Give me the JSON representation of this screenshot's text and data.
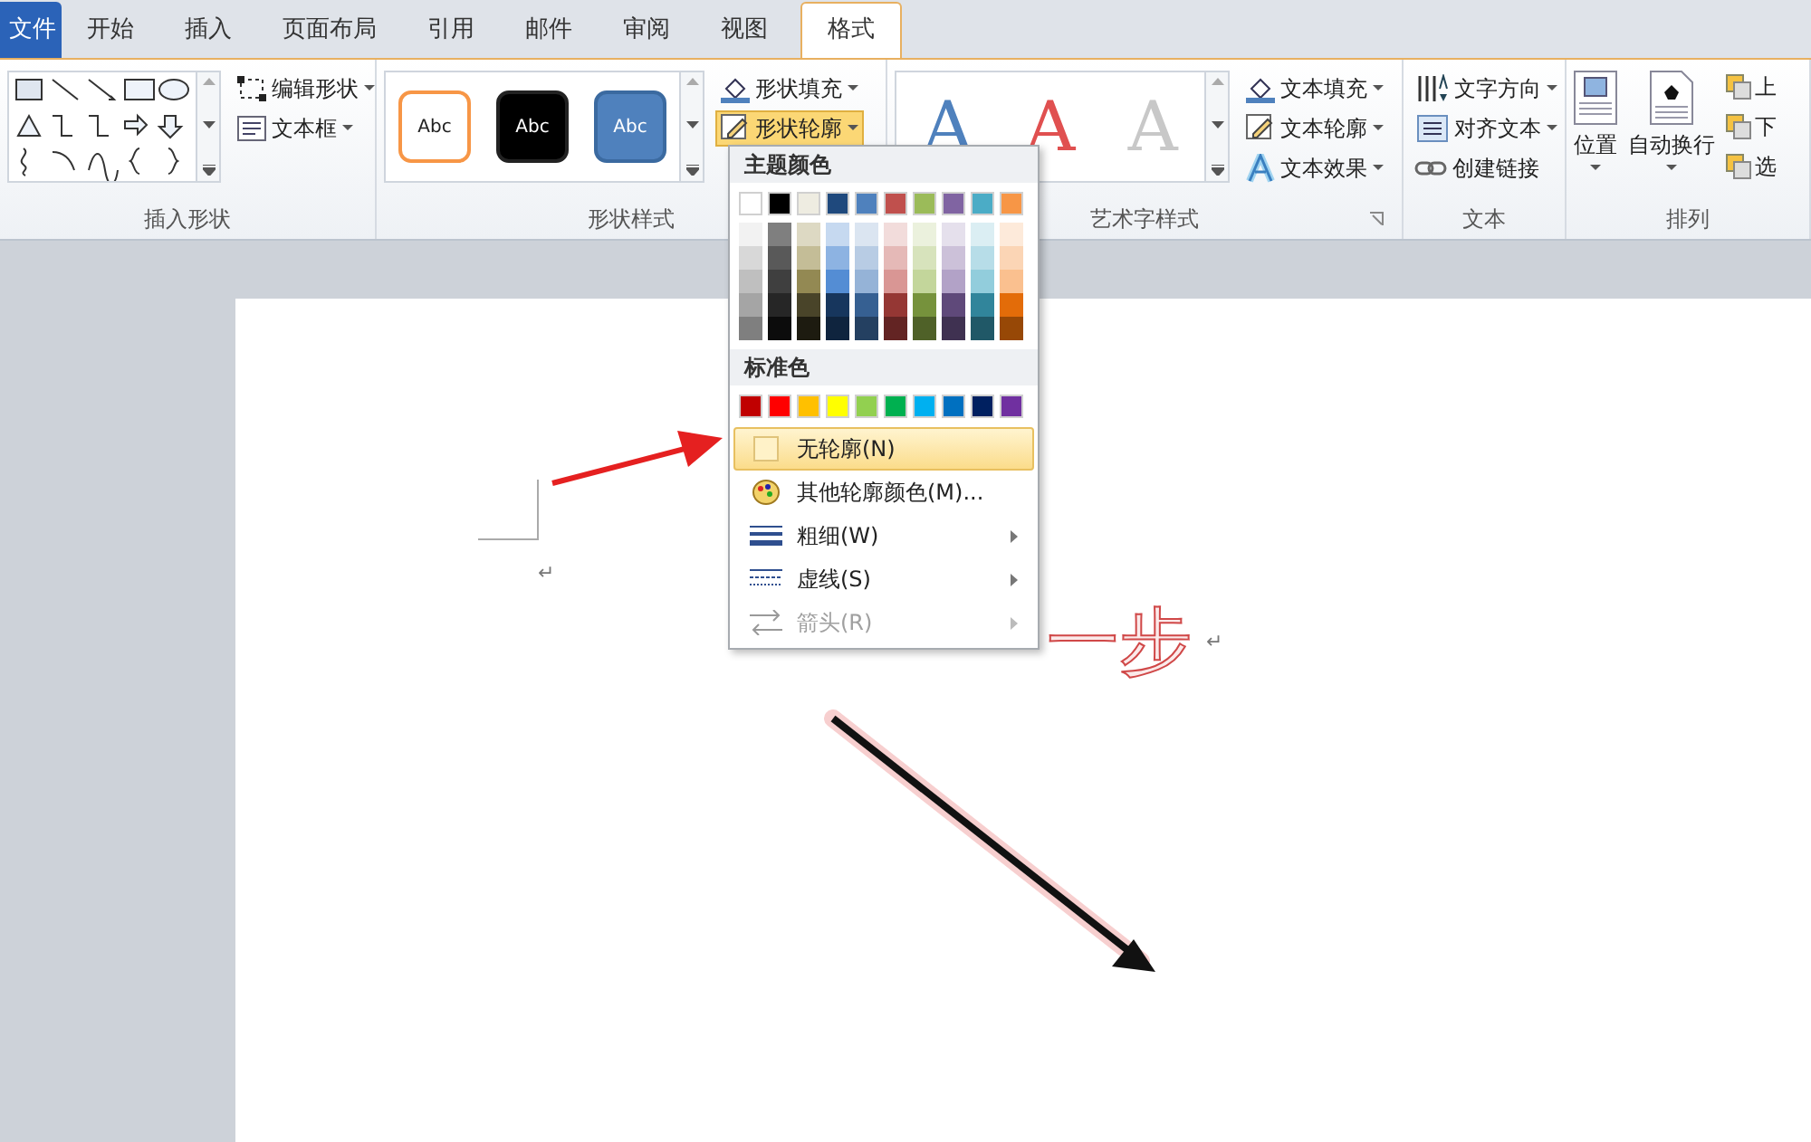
{
  "tabs": [
    {
      "label": "文件",
      "kind": "file",
      "selected": false
    },
    {
      "label": "开始",
      "kind": "tab",
      "selected": false
    },
    {
      "label": "插入",
      "kind": "tab",
      "selected": false
    },
    {
      "label": "页面布局",
      "kind": "tab",
      "selected": false
    },
    {
      "label": "引用",
      "kind": "tab",
      "selected": false
    },
    {
      "label": "邮件",
      "kind": "tab",
      "selected": false
    },
    {
      "label": "审阅",
      "kind": "tab",
      "selected": false
    },
    {
      "label": "视图",
      "kind": "tab",
      "selected": false
    },
    {
      "label": "格式",
      "kind": "tab",
      "selected": true
    }
  ],
  "insert_shapes": {
    "label": "插入形状",
    "buttons": [
      {
        "label": "编辑形状",
        "kind": "edit"
      },
      {
        "label": "文本框",
        "kind": "textbox"
      }
    ]
  },
  "shape_styles": {
    "label": "形状样式",
    "thumbnails": [
      {
        "text": "Abc",
        "kind": "outline"
      },
      {
        "text": "Abc",
        "kind": "dark"
      },
      {
        "text": "Abc",
        "kind": "blue"
      }
    ],
    "buttons": [
      {
        "label": "形状填充",
        "kind": "fill",
        "selected": false
      },
      {
        "label": "形状轮廓",
        "kind": "outline",
        "selected": true
      }
    ]
  },
  "wordart_styles": {
    "label": "艺术字样式",
    "letters": [
      {
        "text": "A",
        "color": "#4f81bd"
      },
      {
        "text": "A",
        "color": "#e05050"
      },
      {
        "text": "A",
        "color": "#c8c8c8"
      }
    ],
    "buttons": [
      {
        "label": "文本填充",
        "kind": "fill"
      },
      {
        "label": "文本轮廓",
        "kind": "outline"
      },
      {
        "label": "文本效果",
        "kind": "effect"
      }
    ]
  },
  "text_group": {
    "label": "文本",
    "buttons": [
      {
        "label": "文字方向",
        "kind": "direction"
      },
      {
        "label": "对齐文本",
        "kind": "align"
      },
      {
        "label": "创建链接",
        "kind": "link"
      }
    ]
  },
  "arrange": {
    "label": "排列",
    "large_buttons": [
      {
        "label": "位置",
        "kind": "position"
      },
      {
        "label": "自动换行",
        "kind": "wrap"
      }
    ],
    "small_buttons": [
      "上",
      "下",
      "选"
    ]
  },
  "outline_menu": {
    "theme_header": "主题颜色",
    "theme_colors": [
      {
        "color": "#ffffff",
        "shades": [
          {
            "color": "#f2f2f2"
          },
          {
            "color": "#d8d8d8"
          },
          {
            "color": "#bfbfbf"
          },
          {
            "color": "#a5a5a5"
          },
          {
            "color": "#7f7f7f"
          }
        ]
      },
      {
        "color": "#000000",
        "shades": [
          {
            "color": "#7f7f7f"
          },
          {
            "color": "#595959"
          },
          {
            "color": "#3f3f3f"
          },
          {
            "color": "#262626"
          },
          {
            "color": "#0c0c0c"
          }
        ]
      },
      {
        "color": "#eeece1",
        "shades": [
          {
            "color": "#ddd9c3"
          },
          {
            "color": "#c4bd97"
          },
          {
            "color": "#938953"
          },
          {
            "color": "#494429"
          },
          {
            "color": "#1d1b10"
          }
        ]
      },
      {
        "color": "#1f497d",
        "shades": [
          {
            "color": "#c6d9f0"
          },
          {
            "color": "#8db3e2"
          },
          {
            "color": "#548dd4"
          },
          {
            "color": "#17365d"
          },
          {
            "color": "#0f243e"
          }
        ]
      },
      {
        "color": "#4f81bd",
        "shades": [
          {
            "color": "#dbe5f1"
          },
          {
            "color": "#b8cce4"
          },
          {
            "color": "#95b3d7"
          },
          {
            "color": "#366092"
          },
          {
            "color": "#244061"
          }
        ]
      },
      {
        "color": "#c0504d",
        "shades": [
          {
            "color": "#f2dcdb"
          },
          {
            "color": "#e5b9b7"
          },
          {
            "color": "#d99694"
          },
          {
            "color": "#953734"
          },
          {
            "color": "#632423"
          }
        ]
      },
      {
        "color": "#9bbb59",
        "shades": [
          {
            "color": "#ebf1dd"
          },
          {
            "color": "#d7e3bc"
          },
          {
            "color": "#c3d69b"
          },
          {
            "color": "#76923c"
          },
          {
            "color": "#4f6128"
          }
        ]
      },
      {
        "color": "#8064a2",
        "shades": [
          {
            "color": "#e5e0ec"
          },
          {
            "color": "#ccc1d9"
          },
          {
            "color": "#b2a2c7"
          },
          {
            "color": "#5f497a"
          },
          {
            "color": "#3f3151"
          }
        ]
      },
      {
        "color": "#4bacc6",
        "shades": [
          {
            "color": "#dbeef3"
          },
          {
            "color": "#b7dde8"
          },
          {
            "color": "#92cddc"
          },
          {
            "color": "#31859b"
          },
          {
            "color": "#205867"
          }
        ]
      },
      {
        "color": "#f79646",
        "shades": [
          {
            "color": "#fdeada"
          },
          {
            "color": "#fbd5b5"
          },
          {
            "color": "#fac08f"
          },
          {
            "color": "#e36c09"
          },
          {
            "color": "#974806"
          }
        ]
      }
    ],
    "standard_header": "标准色",
    "standard_colors": [
      {
        "color": "#c00000"
      },
      {
        "color": "#ff0000"
      },
      {
        "color": "#ffc000"
      },
      {
        "color": "#ffff00"
      },
      {
        "color": "#92d050"
      },
      {
        "color": "#00b050"
      },
      {
        "color": "#00b0f0"
      },
      {
        "color": "#0070c0"
      },
      {
        "color": "#002060"
      },
      {
        "color": "#7030a0"
      }
    ],
    "items": [
      {
        "label": "无轮廓(N)",
        "kind": "none",
        "highlighted": true,
        "disabled": false,
        "submenu": false
      },
      {
        "label": "其他轮廓颜色(M)...",
        "kind": "palette",
        "highlighted": false,
        "disabled": false,
        "submenu": false
      },
      {
        "label": "粗细(W)",
        "kind": "weight",
        "highlighted": false,
        "disabled": false,
        "submenu": true
      },
      {
        "label": "虚线(S)",
        "kind": "dash",
        "highlighted": false,
        "disabled": false,
        "submenu": true
      },
      {
        "label": "箭头(R)",
        "kind": "arrows",
        "highlighted": false,
        "disabled": true,
        "submenu": true
      }
    ]
  },
  "document": {
    "paragraph_marks": [
      "↵",
      "↵"
    ],
    "wordart_text": "一步"
  }
}
